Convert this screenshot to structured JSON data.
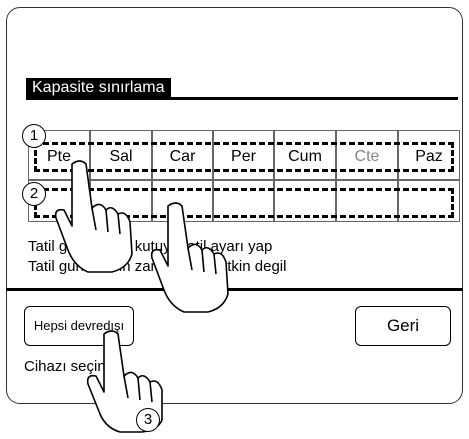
{
  "title": "Kapasite sınırlama",
  "days": [
    {
      "label": "Pte",
      "muted": false
    },
    {
      "label": "Sal",
      "muted": false
    },
    {
      "label": "Car",
      "muted": false
    },
    {
      "label": "Per",
      "muted": false
    },
    {
      "label": "Cum",
      "muted": false
    },
    {
      "label": "Cte",
      "muted": true
    },
    {
      "label": "Paz",
      "muted": false
    }
  ],
  "info_lines": [
    "Tatil gunleri icin kutuya tatil ayarı yap",
    "Tatil gunleri icin zamanlayıcı etkin degil"
  ],
  "buttons": {
    "disable_all": "Hepsi devredışı",
    "back": "Geri"
  },
  "status_text": "Cihazı seçin",
  "markers": [
    "1",
    "2",
    "3"
  ],
  "colors": {
    "muted_text": "#888888",
    "title_bg": "#000000"
  }
}
